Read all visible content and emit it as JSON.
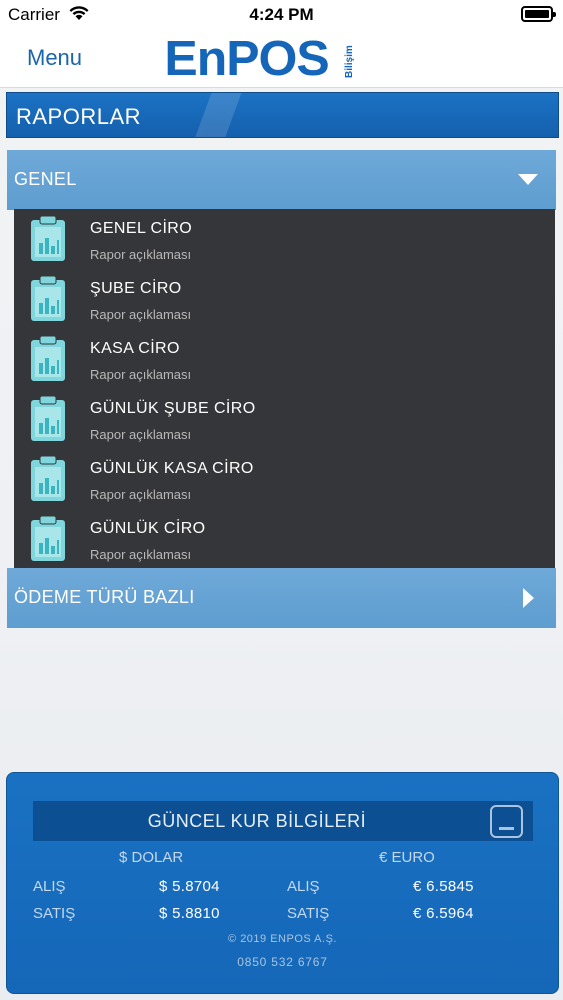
{
  "status_bar": {
    "carrier": "Carrier",
    "time": "4:24 PM"
  },
  "nav": {
    "menu_label": "Menu",
    "logo_text": "EnPOS",
    "logo_sub": "Bilişim"
  },
  "section": {
    "title": "RAPORLAR"
  },
  "groups": [
    {
      "label": "GENEL",
      "expanded": true
    },
    {
      "label": "ÖDEME TÜRÜ BAZLI",
      "expanded": false
    }
  ],
  "reports": [
    {
      "title": "GENEL CİRO",
      "desc": "Rapor açıklaması"
    },
    {
      "title": "ŞUBE CİRO",
      "desc": "Rapor açıklaması"
    },
    {
      "title": "KASA CİRO",
      "desc": "Rapor açıklaması"
    },
    {
      "title": "GÜNLÜK ŞUBE CİRO",
      "desc": "Rapor açıklaması"
    },
    {
      "title": "GÜNLÜK KASA CİRO",
      "desc": "Rapor açıklaması"
    },
    {
      "title": "GÜNLÜK CİRO",
      "desc": "Rapor açıklaması"
    }
  ],
  "currency": {
    "title": "GÜNCEL KUR BİLGİLERİ",
    "dollar_head": "$ DOLAR",
    "euro_head": "€ EURO",
    "buy_label": "ALIŞ",
    "sell_label": "SATIŞ",
    "dollar_buy": "$ 5.8704",
    "dollar_sell": "$ 5.8810",
    "euro_buy": "€ 6.5845",
    "euro_sell": "€ 6.5964"
  },
  "footer": {
    "copyright": "© 2019 ENPOS A.Ş.",
    "phone": "0850 532 6767"
  },
  "colors": {
    "brand_blue": "#1565b8",
    "group_header": "#6ea9d8",
    "list_bg": "#353639",
    "icon_teal": "#7fd6dc"
  },
  "icons": [
    "wifi-icon",
    "battery-icon",
    "chevron-down-icon",
    "chevron-right-icon",
    "report-chart-icon",
    "minimize-icon"
  ]
}
